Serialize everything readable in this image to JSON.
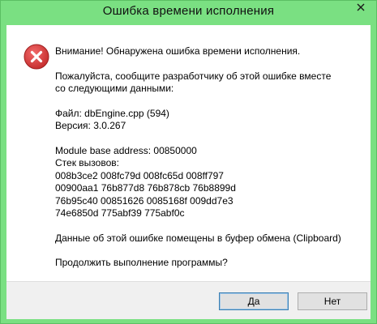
{
  "window": {
    "title": "Ошибка времени исполнения"
  },
  "titlebar": {
    "close_icon": "close-icon",
    "close_glyph": "✕"
  },
  "icons": {
    "error": "error-icon",
    "error_color": "#d63838"
  },
  "message": {
    "header": "Внимание! Обнаружена ошибка времени исполнения.",
    "report_line1": "Пожалуйста, сообщите разработчику об этой ошибке вместе",
    "report_line2": "со следующими данными:",
    "file": "Файл: dbEngine.cpp (594)",
    "version": "Версия: 3.0.267",
    "module_base": "Module base address: 00850000",
    "stack_header": "Стек вызовов:",
    "stack_lines": [
      "008b3ce2 008fc79d 008fc65d 008ff797",
      "00900aa1 76b877d8 76b878cb 76b8899d",
      "76b95c40 00851626 0085168f 009dd7e3",
      "74e6850d 775abf39 775abf0c"
    ],
    "clipboard": "Данные об этой ошибке помещены в буфер обмена (Clipboard)",
    "question": "Продолжить выполнение программы?"
  },
  "buttons": {
    "yes": "Да",
    "no": "Нет"
  },
  "colors": {
    "title_bar": "#7ae082",
    "footer": "#f0f0f0",
    "default_button_border": "#3c7fb1"
  }
}
